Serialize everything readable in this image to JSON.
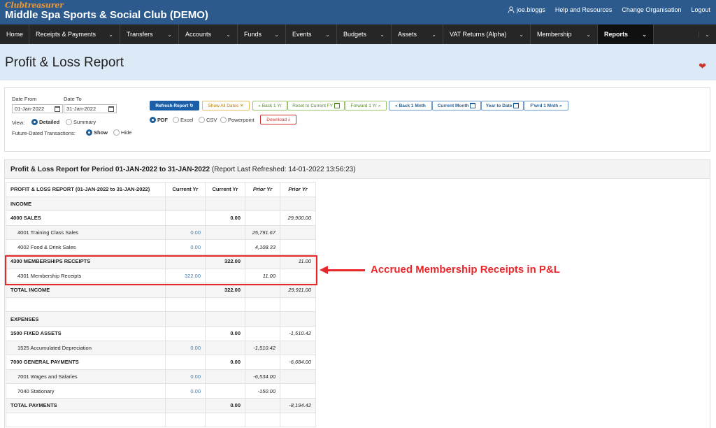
{
  "header": {
    "logo": "Clubtreasurer",
    "club_name": "Middle Spa Sports & Social Club (DEMO)",
    "user": "joe.bloggs",
    "help": "Help and Resources",
    "change_org": "Change Organisation",
    "logout": "Logout"
  },
  "nav": {
    "items": [
      {
        "label": "Home"
      },
      {
        "label": "Receipts & Payments"
      },
      {
        "label": "Transfers"
      },
      {
        "label": "Accounts"
      },
      {
        "label": "Funds"
      },
      {
        "label": "Events"
      },
      {
        "label": "Budgets"
      },
      {
        "label": "Assets"
      },
      {
        "label": "VAT Returns (Alpha)"
      },
      {
        "label": "Membership"
      },
      {
        "label": "Reports"
      }
    ]
  },
  "page": {
    "title": "Profit & Loss Report"
  },
  "filters": {
    "date_from_label": "Date From",
    "date_from": "01-Jan-2022",
    "date_to_label": "Date To",
    "date_to": "31-Jan-2022",
    "view_label": "View:",
    "view_detailed": "Detailed",
    "view_summary": "Summary",
    "future_label": "Future-Dated Transactions:",
    "future_show": "Show",
    "future_hide": "Hide",
    "refresh": "Refresh Report",
    "show_all_dates": "Show All Dates",
    "back_1yr": "Back 1 Yr",
    "reset_fy": "Reset to Current FY",
    "forward_1yr": "Forward 1 Yr",
    "back_1mnth": "Back 1 Mnth",
    "current_month": "Current Month",
    "year_to_date": "Year to Date",
    "fwrd_1mnth": "F'wrd 1 Mnth",
    "fmt_pdf": "PDF",
    "fmt_excel": "Excel",
    "fmt_csv": "CSV",
    "fmt_ppt": "Powerpoint",
    "download": "Download"
  },
  "report": {
    "heading": "Profit & Loss Report for Period 01-JAN-2022 to 31-JAN-2022",
    "refreshed": "(Report Last Refreshed: 14-01-2022 13:56:23)",
    "columns": [
      "PROFIT & LOSS REPORT (01-JAN-2022 to 31-JAN-2022)",
      "Current Yr",
      "Current Yr",
      "Prior Yr",
      "Prior Yr"
    ],
    "rows": [
      {
        "label": "INCOME",
        "c1": "",
        "c2": "",
        "p1": "",
        "p2": ""
      },
      {
        "label": "4000 SALES",
        "c1": "",
        "c2": "0.00",
        "p1": "",
        "p2": "29,900.00"
      },
      {
        "label": "4001 Training Class Sales",
        "c1": "0.00",
        "c2": "",
        "p1": "25,791.67",
        "p2": ""
      },
      {
        "label": "4002 Food & Drink Sales",
        "c1": "0.00",
        "c2": "",
        "p1": "4,108.33",
        "p2": ""
      },
      {
        "label": "4300 MEMBERSHIPS RECEIPTS",
        "c1": "",
        "c2": "322.00",
        "p1": "",
        "p2": "11.00"
      },
      {
        "label": "4301 Membership Receipts",
        "c1": "322.00",
        "c2": "",
        "p1": "11.00",
        "p2": ""
      },
      {
        "label": "TOTAL INCOME",
        "c1": "",
        "c2": "322.00",
        "p1": "",
        "p2": "29,911.00"
      },
      {
        "label": "",
        "c1": "",
        "c2": "",
        "p1": "",
        "p2": ""
      },
      {
        "label": "EXPENSES",
        "c1": "",
        "c2": "",
        "p1": "",
        "p2": ""
      },
      {
        "label": "1500 FIXED ASSETS",
        "c1": "",
        "c2": "0.00",
        "p1": "",
        "p2": "-1,510.42"
      },
      {
        "label": "1525 Accumulated Depreciation",
        "c1": "0.00",
        "c2": "",
        "p1": "-1,510.42",
        "p2": ""
      },
      {
        "label": "7000 GENERAL PAYMENTS",
        "c1": "",
        "c2": "0.00",
        "p1": "",
        "p2": "-6,684.00"
      },
      {
        "label": "7001 Wages and Salaries",
        "c1": "0.00",
        "c2": "",
        "p1": "-6,534.00",
        "p2": ""
      },
      {
        "label": "7040 Stationary",
        "c1": "0.00",
        "c2": "",
        "p1": "-150.00",
        "p2": ""
      },
      {
        "label": "TOTAL PAYMENTS",
        "c1": "",
        "c2": "0.00",
        "p1": "",
        "p2": "-8,194.42"
      },
      {
        "label": "",
        "c1": "",
        "c2": "",
        "p1": "",
        "p2": ""
      }
    ]
  },
  "annotation": {
    "text": "Accrued Membership Receipts in P&L",
    "color": "#e8272a"
  }
}
